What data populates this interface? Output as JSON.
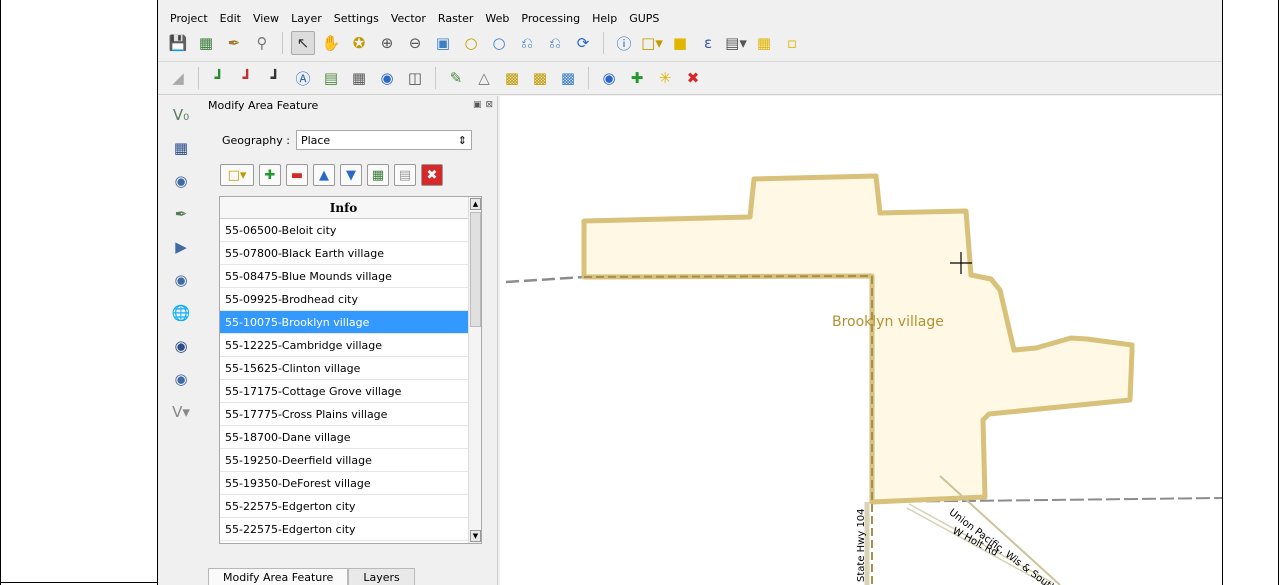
{
  "menu": [
    "Project",
    "Edit",
    "View",
    "Layer",
    "Settings",
    "Vector",
    "Raster",
    "Web",
    "Processing",
    "Help",
    "GUPS"
  ],
  "icons": {
    "toolbar1": [
      "save-icon",
      "new-project-icon",
      "paint-icon",
      "search-icon",
      "select-pointer-icon",
      "pan-hand-icon",
      "pan-to-selection-icon",
      "zoom-in-icon",
      "zoom-out-icon",
      "zoom-full-icon",
      "zoom-to-layer-icon",
      "zoom-to-selection-icon",
      "zoom-last-icon",
      "zoom-next-icon",
      "refresh-icon",
      "identify-icon",
      "select-features-icon",
      "deselect-icon",
      "expression-select-icon",
      "measure-icon",
      "annotation-icon",
      "text-annotation-icon"
    ],
    "toolbar2": [
      "digitize-icon",
      "add-point-icon",
      "delete-point-icon",
      "move-node-icon",
      "label-icon",
      "attribute-table-icon",
      "field-calculator-icon",
      "merge-icon",
      "split-icon",
      "edit-icon",
      "reshape-icon",
      "copy-features-icon",
      "paste-features-icon",
      "cut-features-icon",
      "web-layer-icon",
      "add-marker-icon",
      "star-marker-icon",
      "delete-marker-icon"
    ],
    "side": [
      "add-vector-layer-icon",
      "add-raster-layer-icon",
      "add-postgis-layer-icon",
      "add-spatialite-layer-icon",
      "add-mssql-layer-icon",
      "add-oracle-layer-icon",
      "add-wms-layer-icon",
      "add-wcs-layer-icon",
      "add-wfs-layer-icon",
      "new-layer-icon"
    ]
  },
  "dock": {
    "title": "Modify Area Feature",
    "geography_label": "Geography :",
    "geography_value": "Place",
    "list_header": "Info",
    "items": [
      "55-06500-Beloit city",
      "55-07800-Black Earth village",
      "55-08475-Blue Mounds village",
      "55-09925-Brodhead city",
      "55-10075-Brooklyn village",
      "55-12225-Cambridge village",
      "55-15625-Clinton village",
      "55-17175-Cottage Grove village",
      "55-17775-Cross Plains village",
      "55-18700-Dane village",
      "55-19250-Deerfield village",
      "55-19350-DeForest village",
      "55-22575-Edgerton city",
      "55-22575-Edgerton city"
    ],
    "selected_index": 4,
    "tabs": [
      "Modify Area Feature",
      "Layers"
    ]
  },
  "map": {
    "place_label": "Brooklyn village",
    "roads": [
      "Union Pacific, Wis & Southern",
      "W Holt Rd",
      "State Hwy 104"
    ],
    "colors": {
      "polygon_fill": "#fef8e4",
      "polygon_stroke": "#d8c17a",
      "place_label": "#b39034",
      "selection": "#3399ff"
    }
  }
}
